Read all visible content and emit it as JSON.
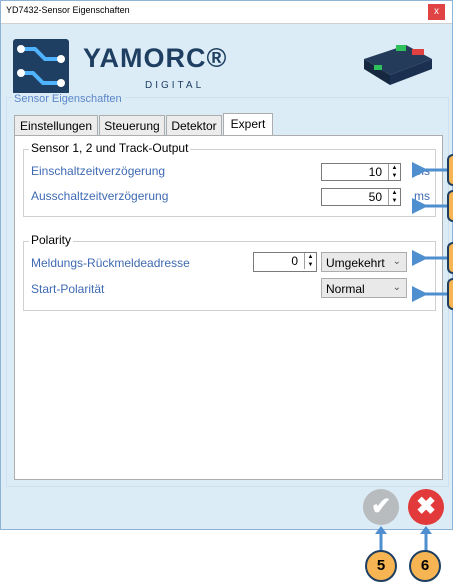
{
  "window": {
    "title": "YD7432-Sensor Eigenschaften",
    "close_glyph": "x"
  },
  "logo": {
    "brand": "YAMORC®",
    "sub": "DIGITAL"
  },
  "group_title": "Sensor Eigenschaften",
  "tabs": [
    {
      "label": "Einstellungen",
      "active": false
    },
    {
      "label": "Steuerung",
      "active": false
    },
    {
      "label": "Detektor",
      "active": false
    },
    {
      "label": "Expert",
      "active": true
    }
  ],
  "sensor_section": {
    "legend": "Sensor 1, 2 und Track-Output",
    "rows": [
      {
        "label": "Einschaltzeitverzögerung",
        "value": "10",
        "unit": "ms"
      },
      {
        "label": "Ausschaltzeitverzögerung",
        "value": "50",
        "unit": "ms"
      }
    ]
  },
  "polarity_section": {
    "legend": "Polarity",
    "feedback_label": "Meldungs-Rückmeldeadresse",
    "feedback_value": "0",
    "feedback_mode": "Umgekehrt",
    "start_label": "Start-Polarität",
    "start_value": "Normal"
  },
  "buttons": {
    "ok_icon": "check-icon",
    "cancel_icon": "x-circle-icon"
  },
  "callouts": {
    "ok": "5",
    "cancel": "6"
  },
  "colors": {
    "accent": "#3f6ab3",
    "brand": "#1e3f61",
    "callout_fill": "#f6b552",
    "arrow": "#4f8fcf",
    "cancel": "#e23a3a"
  }
}
